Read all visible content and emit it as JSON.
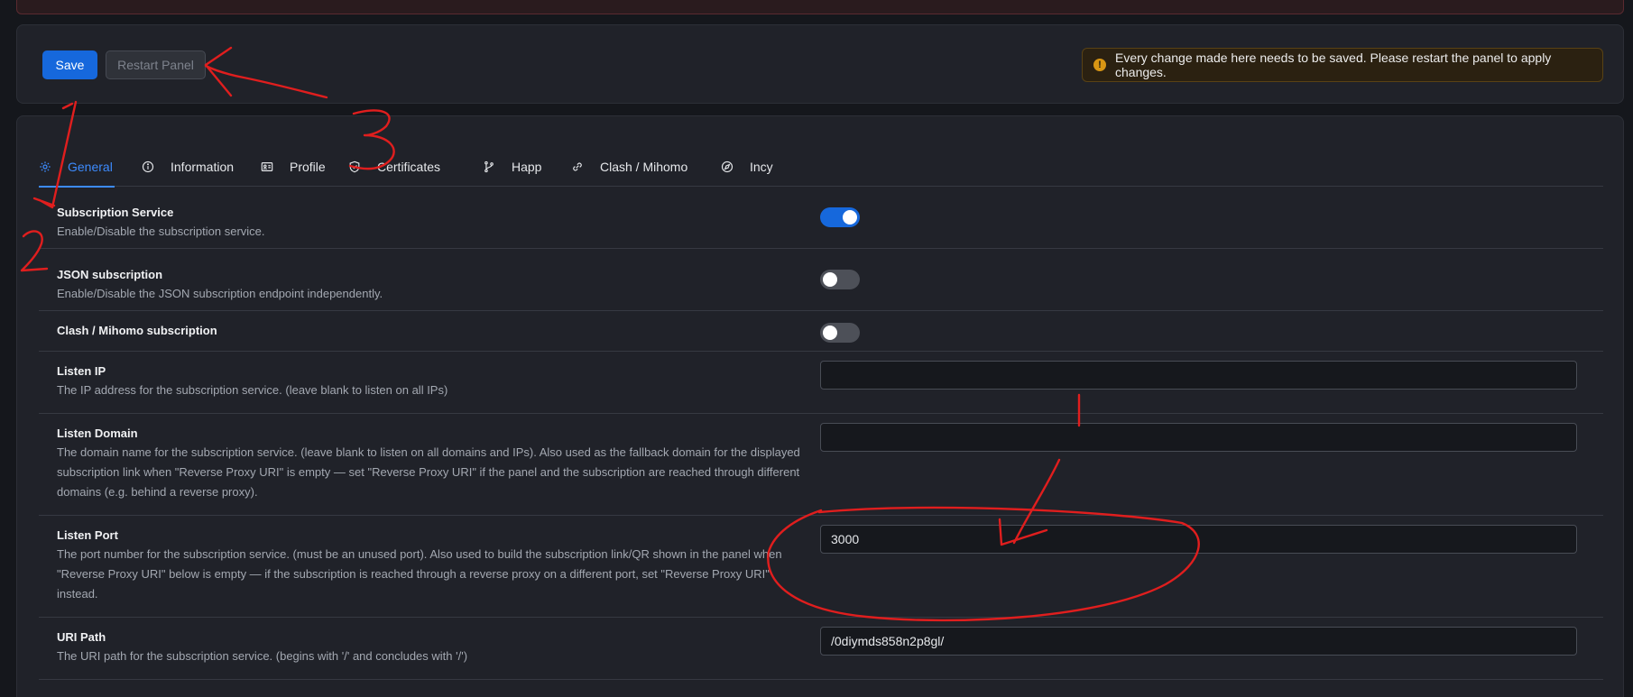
{
  "actions": {
    "save_label": "Save",
    "restart_label": "Restart Panel",
    "notice_icon": "!",
    "notice_text": "Every change made here needs to be saved. Please restart the panel to apply changes."
  },
  "tabs": [
    {
      "label": "General",
      "icon": "gear-icon",
      "active": true
    },
    {
      "label": "Information",
      "icon": "info-icon"
    },
    {
      "label": "Profile",
      "icon": "id-card-icon"
    },
    {
      "label": "Certificates",
      "icon": "shield-check-icon"
    },
    {
      "label": "Happ",
      "icon": "branch-icon"
    },
    {
      "label": "Clash / Mihomo",
      "icon": "link-icon"
    },
    {
      "label": "Incy",
      "icon": "compass-icon"
    }
  ],
  "settings": {
    "subscription_service": {
      "title": "Subscription Service",
      "desc": "Enable/Disable the subscription service.",
      "enabled": true
    },
    "json_subscription": {
      "title": "JSON subscription",
      "desc": "Enable/Disable the JSON subscription endpoint independently.",
      "enabled": false
    },
    "clash_subscription": {
      "title": "Clash / Mihomo subscription",
      "enabled": false
    },
    "listen_ip": {
      "title": "Listen IP",
      "desc": "The IP address for the subscription service. (leave blank to listen on all IPs)",
      "value": ""
    },
    "listen_domain": {
      "title": "Listen Domain",
      "desc": "The domain name for the subscription service. (leave blank to listen on all domains and IPs). Also used as the fallback domain for the displayed subscription link when \"Reverse Proxy URI\" is empty — set \"Reverse Proxy URI\" if the panel and the subscription are reached through different domains (e.g. behind a reverse proxy).",
      "value": ""
    },
    "listen_port": {
      "title": "Listen Port",
      "desc": "The port number for the subscription service. (must be an unused port). Also used to build the subscription link/QR shown in the panel when \"Reverse Proxy URI\" below is empty — if the subscription is reached through a reverse proxy on a different port, set \"Reverse Proxy URI\" instead.",
      "value": "3000"
    },
    "uri_path": {
      "title": "URI Path",
      "desc": "The URI path for the subscription service. (begins with '/' and concludes with '/')",
      "value": "/0diymds858n2p8gl/"
    }
  },
  "annotations": {
    "color": "#e01e1e",
    "labels": [
      "1",
      "2",
      "3",
      "1"
    ]
  }
}
